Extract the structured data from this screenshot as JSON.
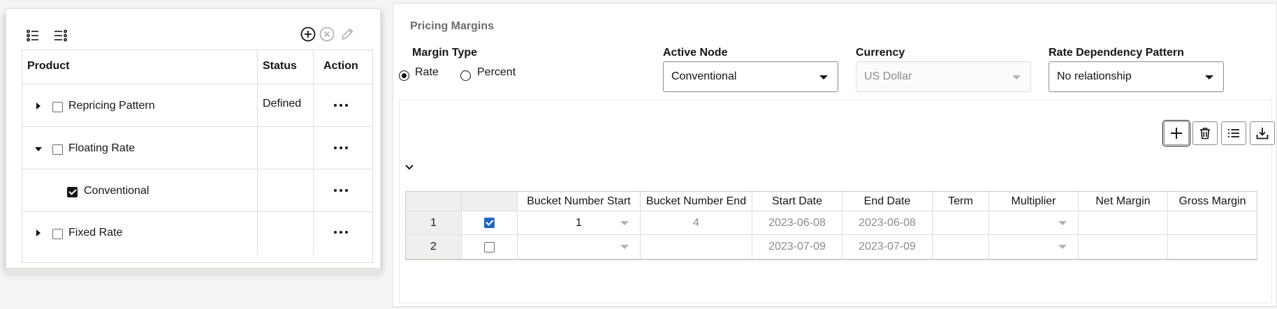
{
  "product_tree": {
    "columns": [
      "Product",
      "Status",
      "Action"
    ],
    "rows": [
      {
        "label": "Repricing Pattern",
        "status": "Defined",
        "expander": "collapsed",
        "checked": false,
        "level": 0
      },
      {
        "label": "Floating Rate",
        "status": "",
        "expander": "expanded",
        "checked": false,
        "level": 0
      },
      {
        "label": "Conventional",
        "status": "",
        "expander": "none",
        "checked": true,
        "level": 1
      },
      {
        "label": "Fixed Rate",
        "status": "",
        "expander": "collapsed",
        "checked": false,
        "level": 0
      }
    ]
  },
  "pricing_margins": {
    "title": "Pricing Margins",
    "margin_type": {
      "label": "Margin Type",
      "options": [
        "Rate",
        "Percent"
      ],
      "selected": "Rate"
    },
    "active_node": {
      "label": "Active Node",
      "value": "Conventional"
    },
    "currency": {
      "label": "Currency",
      "value": "US Dollar",
      "disabled": true
    },
    "rate_dependency": {
      "label": "Rate Dependency Pattern",
      "value": "No relationship"
    }
  },
  "grid": {
    "columns": [
      "Bucket Number Start",
      "Bucket Number End",
      "Start Date",
      "End Date",
      "Term",
      "Multiplier",
      "Net Margin",
      "Gross Margin"
    ],
    "rows": [
      {
        "num": "1",
        "checked": true,
        "bucket_start": "1",
        "bucket_end": "4",
        "start_date": "2023-06-08",
        "end_date": "2023-06-08",
        "term": "",
        "multiplier": "",
        "net_margin": "",
        "gross_margin": ""
      },
      {
        "num": "2",
        "checked": false,
        "bucket_start": "",
        "bucket_end": "",
        "start_date": "2023-07-09",
        "end_date": "2023-07-09",
        "term": "",
        "multiplier": "",
        "net_margin": "",
        "gross_margin": ""
      }
    ]
  },
  "colors": {
    "accent": "#2266c4",
    "text": "#161513",
    "muted": "#8e8c88"
  }
}
